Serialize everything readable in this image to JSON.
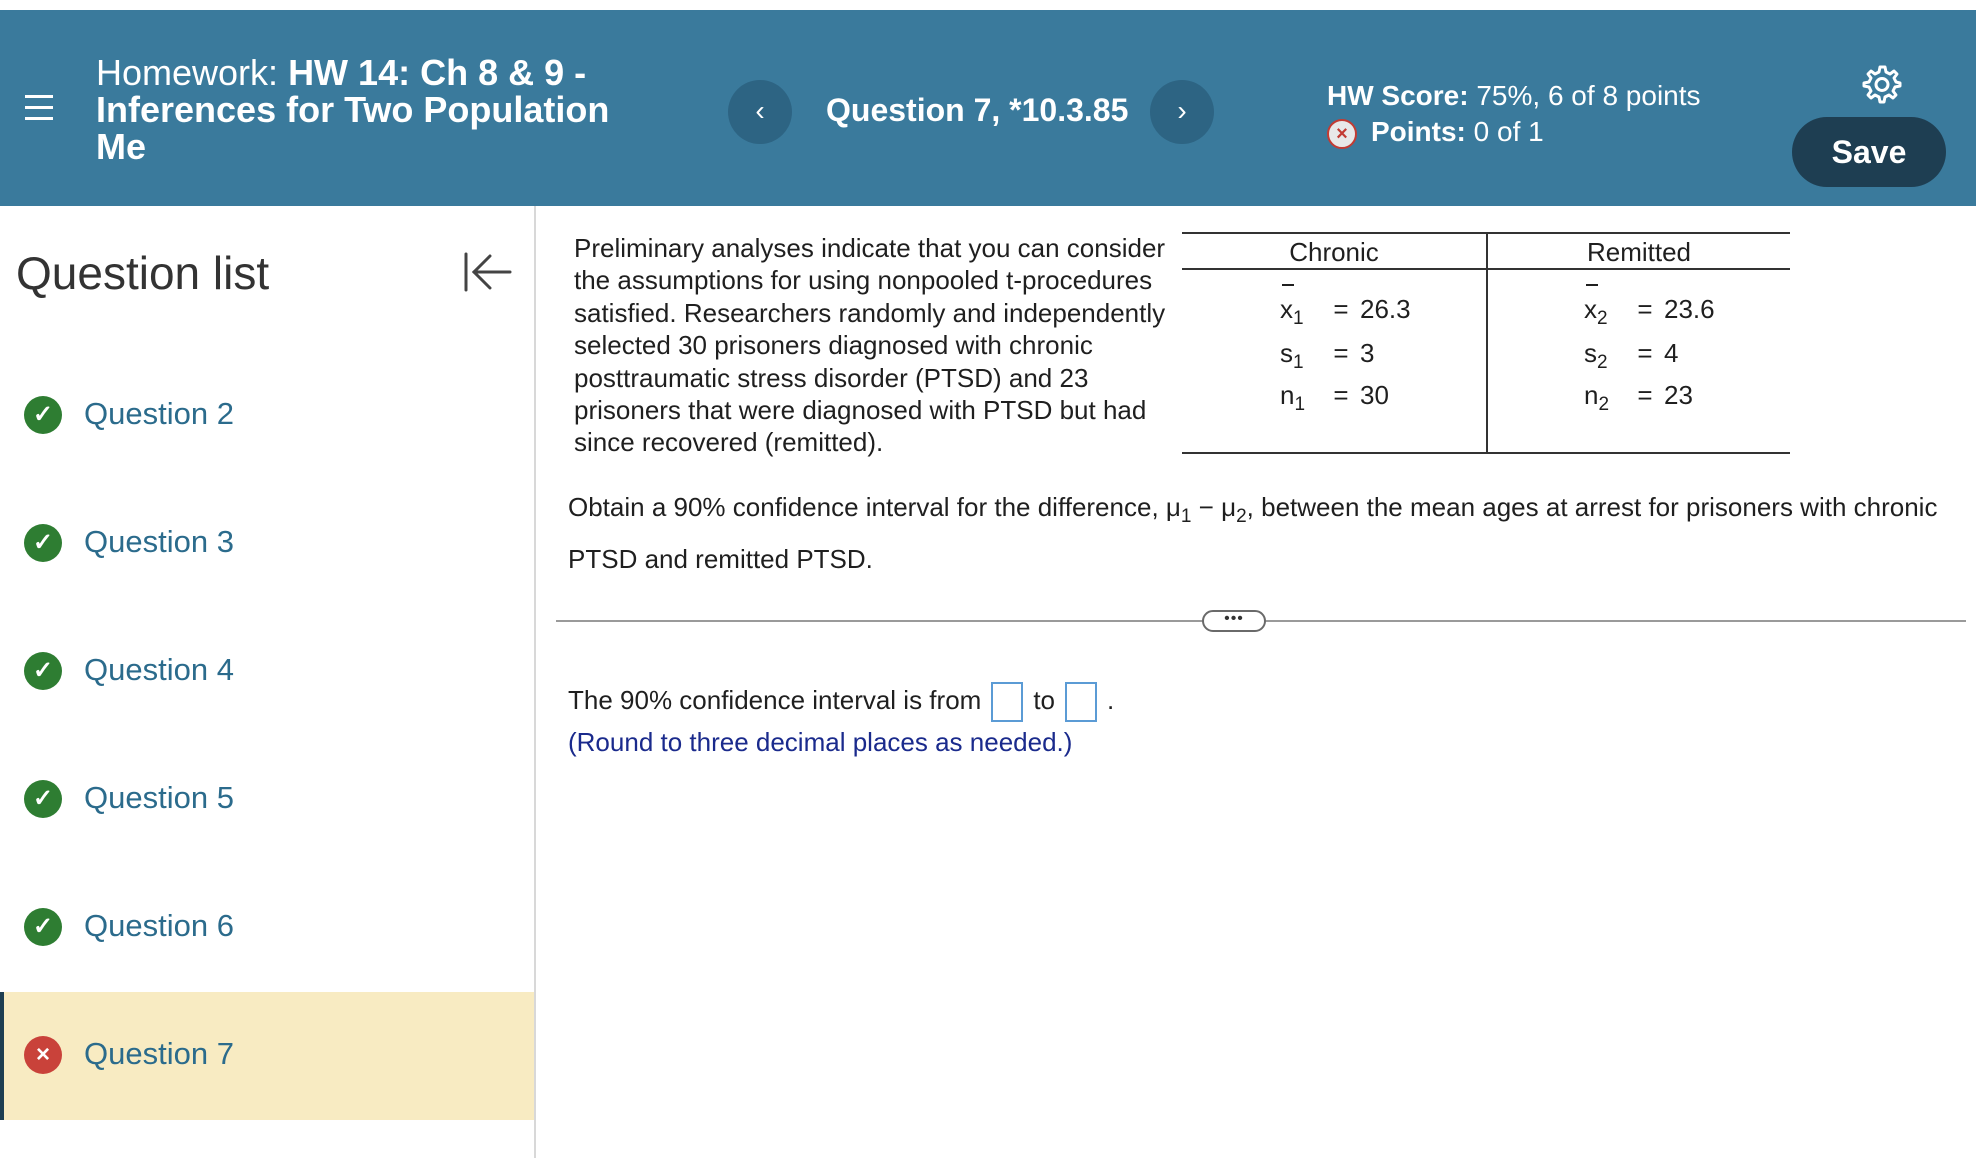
{
  "header": {
    "title_label": "Homework:",
    "title_name": "HW 14: Ch 8 & 9 - Inferences for Two Population Me",
    "question_title": "Question 7, *10.3.85",
    "prev_label": "‹",
    "next_label": "›",
    "hw_score_label": "HW Score:",
    "hw_score_value": "75%, 6 of 8 points",
    "points_label": "Points:",
    "points_value": "0 of 1",
    "save_label": "Save"
  },
  "sidebar": {
    "title": "Question list",
    "items": [
      {
        "label": "Question 2",
        "status": "correct"
      },
      {
        "label": "Question 3",
        "status": "correct"
      },
      {
        "label": "Question 4",
        "status": "correct"
      },
      {
        "label": "Question 5",
        "status": "correct"
      },
      {
        "label": "Question 6",
        "status": "correct"
      },
      {
        "label": "Question 7",
        "status": "incorrect"
      }
    ]
  },
  "problem": {
    "text": "Preliminary analyses indicate that you can consider the assumptions for using nonpooled t-procedures satisfied. Researchers randomly and independently selected 30 prisoners diagnosed with chronic posttraumatic stress disorder (PTSD) and 23 prisoners that were diagnosed with PTSD but had since recovered (remitted).",
    "table": {
      "headers": [
        "Chronic",
        "Remitted"
      ],
      "chronic": {
        "xbar_sym": "x",
        "xbar_sub": "1",
        "xbar": "26.3",
        "s_sym": "s",
        "s_sub": "1",
        "s": "3",
        "n_sym": "n",
        "n_sub": "1",
        "n": "30"
      },
      "remitted": {
        "xbar_sym": "x",
        "xbar_sub": "2",
        "xbar": "23.6",
        "s_sym": "s",
        "s_sub": "2",
        "s": "4",
        "n_sym": "n",
        "n_sub": "2",
        "n": "23"
      },
      "eq": "="
    },
    "obtain_part1": "Obtain a 90% confidence interval for the difference, ",
    "mu1": "μ",
    "mu1_sub": "1",
    "minus": " − ",
    "mu2": "μ",
    "mu2_sub": "2",
    "obtain_part2": ", between the mean ages at arrest for prisoners with chronic PTSD and remitted PTSD.",
    "dots": "•••",
    "answer_prefix": "The 90% confidence interval is from",
    "answer_to": "to",
    "answer_suffix": ".",
    "hint": "(Round to three decimal places as needed.)"
  },
  "colors": {
    "header_bg": "#3a7a9c",
    "save_bg": "#1e3e52",
    "active_row_bg": "#f8ebc2",
    "link": "#2b6b8c",
    "correct": "#2e7d32",
    "incorrect": "#c9423a"
  },
  "icons": [
    "hamburger-menu-icon",
    "chevron-left-icon",
    "chevron-right-icon",
    "x-circle-icon",
    "gear-icon",
    "collapse-left-icon",
    "check-circle-icon"
  ]
}
